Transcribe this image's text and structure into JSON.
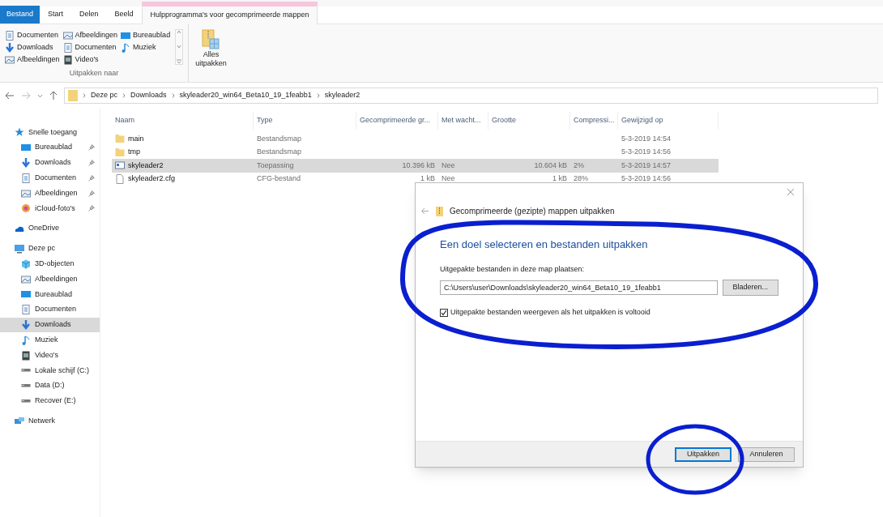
{
  "ribbon_tabs": [
    {
      "label": "Bestand",
      "selected": false,
      "kind": "file"
    },
    {
      "label": "Start",
      "selected": false,
      "kind": "tab"
    },
    {
      "label": "Delen",
      "selected": false,
      "kind": "tab"
    },
    {
      "label": "Beeld",
      "selected": false,
      "kind": "tab"
    },
    {
      "label": "Hulpprogramma's voor gecomprimeerde mappen",
      "selected": true,
      "kind": "tab"
    }
  ],
  "ribbon": {
    "destinations": [
      {
        "label": "Documenten",
        "kind": "documents"
      },
      {
        "label": "Afbeeldingen",
        "kind": "pictures"
      },
      {
        "label": "Bureaublad",
        "kind": "desktop"
      },
      {
        "label": "Downloads",
        "kind": "downloads"
      },
      {
        "label": "Documenten",
        "kind": "documents"
      },
      {
        "label": "Muziek",
        "kind": "music"
      },
      {
        "label": "Afbeeldingen",
        "kind": "pictures"
      },
      {
        "label": "Video's",
        "kind": "video"
      }
    ],
    "group_label": "Uitpakken naar",
    "extract_all": "Alles\nuitpakken"
  },
  "breadcrumb": [
    "Deze pc",
    "Downloads",
    "skyleader20_win64_Beta10_19_1feabb1",
    "skyleader2"
  ],
  "sidebar": {
    "items": [
      {
        "label": "Snelle toegang",
        "kind": "quick",
        "pinned": false,
        "selected": false,
        "children": [
          {
            "label": "Bureaublad",
            "kind": "desktop",
            "pinned": true,
            "selected": false
          },
          {
            "label": "Downloads",
            "kind": "downloads",
            "pinned": true,
            "selected": false
          },
          {
            "label": "Documenten",
            "kind": "documents",
            "pinned": true,
            "selected": false
          },
          {
            "label": "Afbeeldingen",
            "kind": "pictures",
            "pinned": true,
            "selected": false
          },
          {
            "label": "iCloud-foto's",
            "kind": "photos",
            "pinned": true,
            "selected": false
          }
        ]
      },
      {
        "label": "OneDrive",
        "kind": "cloud",
        "pinned": false,
        "selected": false
      },
      {
        "label": "Deze pc",
        "kind": "pc",
        "pinned": false,
        "selected": false,
        "children": [
          {
            "label": "3D-objecten",
            "kind": "cube",
            "pinned": false,
            "selected": false
          },
          {
            "label": "Afbeeldingen",
            "kind": "pictures",
            "pinned": false,
            "selected": false
          },
          {
            "label": "Bureaublad",
            "kind": "desktop",
            "pinned": false,
            "selected": false
          },
          {
            "label": "Documenten",
            "kind": "documents",
            "pinned": false,
            "selected": false
          },
          {
            "label": "Downloads",
            "kind": "downloads",
            "pinned": false,
            "selected": true
          },
          {
            "label": "Muziek",
            "kind": "music",
            "pinned": false,
            "selected": false
          },
          {
            "label": "Video's",
            "kind": "video",
            "pinned": false,
            "selected": false
          },
          {
            "label": "Lokale schijf (C:)",
            "kind": "drive",
            "pinned": false,
            "selected": false
          },
          {
            "label": "Data (D:)",
            "kind": "drive",
            "pinned": false,
            "selected": false
          },
          {
            "label": "Recover (E:)",
            "kind": "drive",
            "pinned": false,
            "selected": false
          }
        ]
      },
      {
        "label": "Netwerk",
        "kind": "network",
        "pinned": false,
        "selected": false
      }
    ]
  },
  "table": {
    "columns": [
      "Naam",
      "Type",
      "Gecomprimeerde gr...",
      "Met wacht...",
      "Grootte",
      "Compressi...",
      "Gewijzigd op"
    ],
    "rows": [
      {
        "kind": "folder",
        "selected": false,
        "cells": [
          "main",
          "Bestandsmap",
          "",
          "",
          "",
          "",
          "5-3-2019 14:54"
        ]
      },
      {
        "kind": "folder",
        "selected": false,
        "cells": [
          "tmp",
          "Bestandsmap",
          "",
          "",
          "",
          "",
          "5-3-2019 14:56"
        ]
      },
      {
        "kind": "app",
        "selected": true,
        "cells": [
          "skyleader2",
          "Toepassing",
          "10.396 kB",
          "Nee",
          "10.604 kB",
          "2%",
          "5-3-2019 14:57"
        ]
      },
      {
        "kind": "file",
        "selected": false,
        "cells": [
          "skyleader2.cfg",
          "CFG-bestand",
          "1 kB",
          "Nee",
          "1 kB",
          "28%",
          "5-3-2019 14:56"
        ]
      }
    ]
  },
  "dialog": {
    "title": "Gecomprimeerde (gezipte) mappen uitpakken",
    "heading": "Een doel selecteren en bestanden uitpakken",
    "field_label": "Uitgepakte bestanden in deze map plaatsen:",
    "path": "C:\\Users\\user\\Downloads\\skyleader20_win64_Beta10_19_1feabb1",
    "browse": "Bladeren...",
    "show_files": {
      "label": "Uitgepakte bestanden weergeven als het uitpakken is voltooid",
      "checked": true
    },
    "buttons": [
      {
        "label": "Uitpakken",
        "kind": "default"
      },
      {
        "label": "Annuleren",
        "kind": "normal"
      }
    ]
  }
}
